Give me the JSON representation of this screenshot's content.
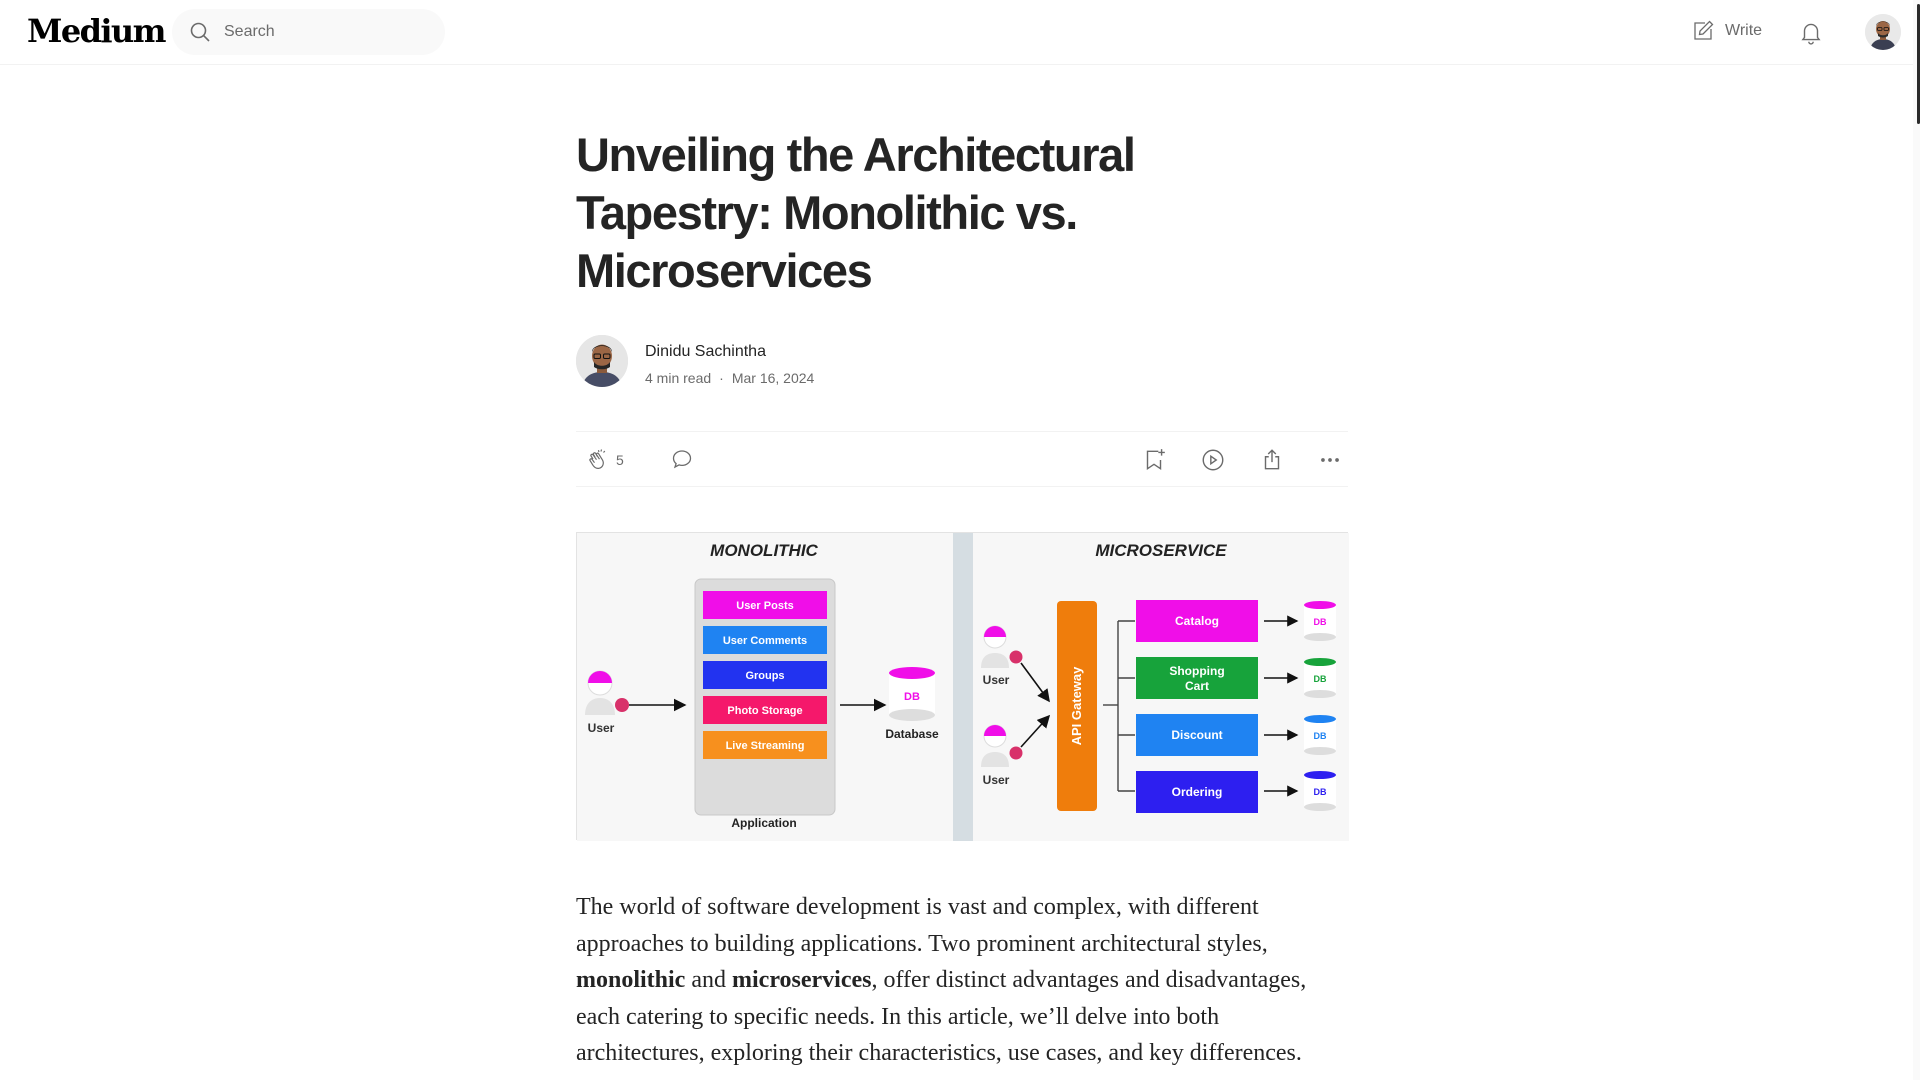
{
  "header": {
    "logo": "Medium",
    "search_placeholder": "Search",
    "write_label": "Write"
  },
  "article": {
    "title": "Unveiling the Architectural Tapestry: Monolithic vs. Microservices",
    "author": {
      "name": "Dinidu Sachintha",
      "read_time": "4 min read",
      "separator": "·",
      "date": "Mar 16, 2024"
    },
    "actions": {
      "clap_count": "5"
    },
    "hero": {
      "mono_title": "MONOLITHIC",
      "micro_title": "MICROSERVICE",
      "mono_modules": [
        "User Posts",
        "User Comments",
        "Groups",
        "Photo Storage",
        "Live Streaming"
      ],
      "mono_module_colors": [
        "#f00ee8",
        "#1f83f2",
        "#2233f0",
        "#f5186b",
        "#f7901e"
      ],
      "user_label": "User",
      "database_label": "Database",
      "db_label": "DB",
      "application_label": "Application",
      "gateway_label": "API Gateway",
      "services": [
        "Catalog",
        "Shopping",
        "Cart",
        "Discount",
        "Ordering"
      ],
      "service_colors": [
        "#f00ee8",
        "#17a33b",
        "#1f83f2",
        "#2d1ff0"
      ]
    },
    "body": {
      "p1_a": "The world of software development is vast and complex, with different approaches to building applications. Two prominent architectural styles, ",
      "p1_bold1": "monolithic",
      "p1_and": " and ",
      "p1_bold2": "microservices",
      "p1_b": ", offer distinct advantages and disadvantages, each catering to specific needs. In this article, we’ll delve into both architectures, exploring their characteristics, use cases, and key differences."
    }
  },
  "colors": {
    "text": "#242424",
    "muted": "#6b6b6b",
    "gateway": "#ef7d0c"
  }
}
